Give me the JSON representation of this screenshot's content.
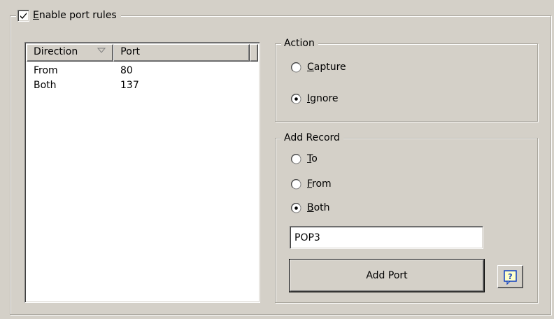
{
  "port_rules": {
    "enable_label_mnemonic": "E",
    "enable_label_rest": "nable port rules",
    "enabled": true
  },
  "list": {
    "columns": [
      "Direction",
      "Port"
    ],
    "rows": [
      {
        "direction": "From",
        "port": "80"
      },
      {
        "direction": "Both",
        "port": "137"
      }
    ]
  },
  "action": {
    "title": "Action",
    "options": [
      {
        "mnemonic": "C",
        "rest": "apture",
        "selected": false
      },
      {
        "mnemonic": "I",
        "rest": "gnore",
        "selected": true
      }
    ]
  },
  "add_record": {
    "title": "Add Record",
    "options": [
      {
        "mnemonic": "T",
        "rest": "o",
        "selected": false
      },
      {
        "mnemonic": "F",
        "rest": "rom",
        "selected": false
      },
      {
        "mnemonic": "B",
        "rest": "oth",
        "selected": true
      }
    ],
    "name_value": "POP3",
    "add_button_label": "Add Port"
  },
  "colors": {
    "dialog_bg": "#d4d0c8",
    "help_icon_blue": "#1040c0",
    "help_icon_yellow": "#ffffc8"
  }
}
